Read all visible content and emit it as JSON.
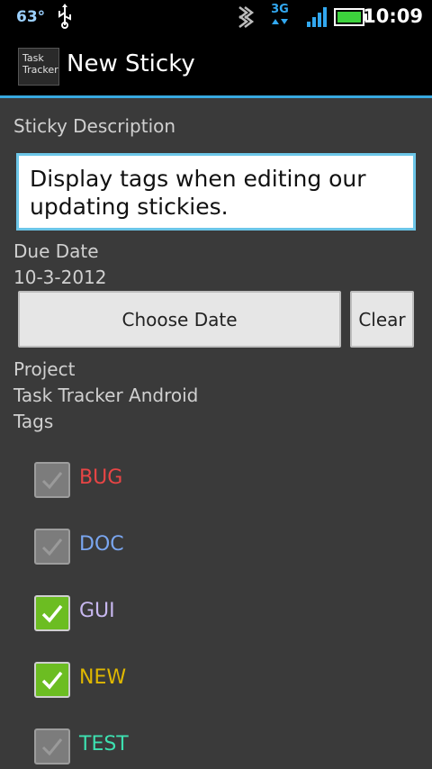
{
  "status_bar": {
    "temperature": "63°",
    "network": "3G",
    "time": "10:09"
  },
  "title_bar": {
    "icon_text_line1": "Task",
    "icon_text_line2": "Tracker",
    "title": "New Sticky"
  },
  "form": {
    "description_label": "Sticky Description",
    "description_value": "Display tags when editing our updating stickies.",
    "due_date_label": "Due Date",
    "due_date_value": "10-3-2012",
    "choose_date_button": "Choose Date",
    "clear_button": "Clear",
    "project_label": "Project",
    "project_value": "Task Tracker Android",
    "tags_label": "Tags"
  },
  "tags": [
    {
      "label": "BUG",
      "checked": false,
      "color": "#e84545"
    },
    {
      "label": "DOC",
      "checked": false,
      "color": "#7aa6f0"
    },
    {
      "label": "GUI",
      "checked": true,
      "color": "#c8b8f0"
    },
    {
      "label": "NEW",
      "checked": true,
      "color": "#e0b800"
    },
    {
      "label": "TEST",
      "checked": false,
      "color": "#3de0b0"
    }
  ],
  "colors": {
    "accent": "#38a9e0",
    "background": "#3a3a3a",
    "checkbox_on": "#6cbd22"
  }
}
